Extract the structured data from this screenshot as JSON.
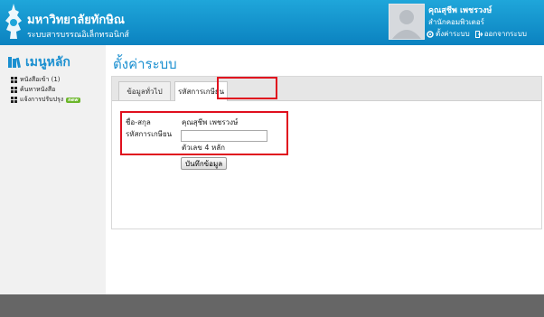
{
  "header": {
    "university_name": "มหาวิทยาลัยทักษิณ",
    "system_name": "ระบบสารบรรณอิเล็กทรอนิกส์",
    "user_name": "คุณสุชีพ เพชรวงษ์",
    "user_department": "สำนักคอมพิวเตอร์",
    "settings_link": "ตั้งค่าระบบ",
    "logout_link": "ออกจากระบบ"
  },
  "sidebar": {
    "menu_title": "เมนูหลัก",
    "items": [
      {
        "label": "หนังสือเข้า (1)"
      },
      {
        "label": "ค้นหาหนังสือ"
      },
      {
        "label": "แจ้งการปรับปรุง",
        "badge": "new"
      }
    ]
  },
  "main": {
    "page_title": "ตั้งค่าระบบ",
    "tabs": [
      {
        "label": "ข้อมูลทั่วไป",
        "active": false
      },
      {
        "label": "รหัสการเกษียน",
        "active": true
      }
    ],
    "form": {
      "name_label": "ชื่อ-สกุล",
      "name_value": "คุณสุชีพ เพชรวงษ์",
      "code_label": "รหัสการเกษียน",
      "code_value": "",
      "code_hint": "ตัวเลข 4 หลัก",
      "save_label": "บันทึกข้อมูล"
    }
  },
  "colors": {
    "header_blue": "#0b82c0",
    "accent_blue": "#1a8fd0",
    "highlight_red": "#e0101e",
    "badge_green": "#6bb62a"
  }
}
